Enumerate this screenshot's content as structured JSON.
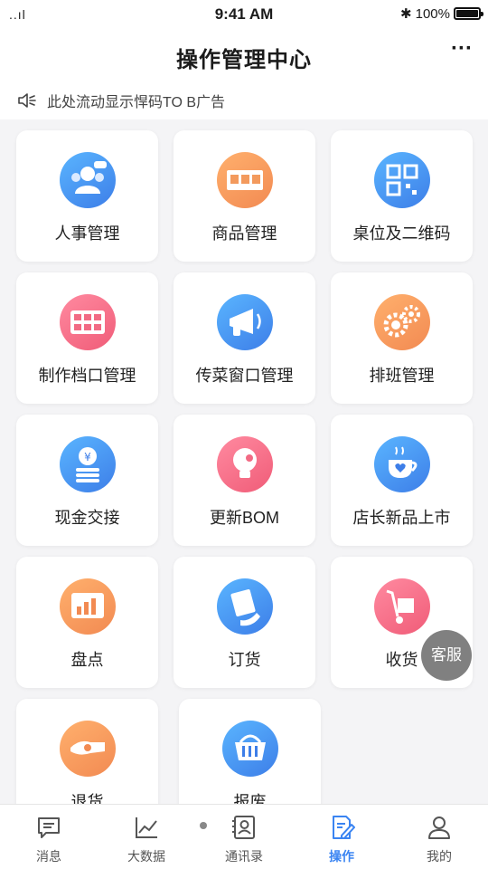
{
  "status": {
    "time": "9:41 AM",
    "signal": "..ıl",
    "wifi": "ᯤ",
    "bluetooth": "✱",
    "battery_text": "100%"
  },
  "navbar": {
    "title": "操作管理中心",
    "more": "···"
  },
  "notice": {
    "text": "此处流动显示悍码TO B广告"
  },
  "tiles": [
    {
      "label": "人事管理",
      "icon": "people-icon",
      "color": "#4c93f0"
    },
    {
      "label": "商品管理",
      "icon": "store-icon",
      "color": "#f39a5d"
    },
    {
      "label": "桌位及二维码",
      "icon": "qrcode-icon",
      "color": "#4c93f0"
    },
    {
      "label": "制作档口管理",
      "icon": "grid-window-icon",
      "color": "#f26a84"
    },
    {
      "label": "传菜窗口管理",
      "icon": "megaphone-icon",
      "color": "#4c93f0"
    },
    {
      "label": "排班管理",
      "icon": "gears-icon",
      "color": "#f39a5d"
    },
    {
      "label": "现金交接",
      "icon": "coins-icon",
      "color": "#4c93f0"
    },
    {
      "label": "更新BOM",
      "icon": "bulb-icon",
      "color": "#f26a84"
    },
    {
      "label": "店长新品上市",
      "icon": "cup-heart-icon",
      "color": "#4c93f0"
    },
    {
      "label": "盘点",
      "icon": "chart-board-icon",
      "color": "#f39a5d"
    },
    {
      "label": "订货",
      "icon": "order-hand-icon",
      "color": "#4c93f0"
    },
    {
      "label": "收货",
      "icon": "cart-icon",
      "color": "#f26a84"
    },
    {
      "label": "退货",
      "icon": "return-hand-icon",
      "color": "#f39a5d"
    },
    {
      "label": "报废",
      "icon": "basket-icon",
      "color": "#4c93f0"
    }
  ],
  "floating": {
    "label": "客服"
  },
  "tabbar": [
    {
      "label": "消息",
      "icon": "message-icon",
      "active": false
    },
    {
      "label": "大数据",
      "icon": "trend-chart-icon",
      "active": false
    },
    {
      "label": "通讯录",
      "icon": "contacts-icon",
      "active": false
    },
    {
      "label": "操作",
      "icon": "edit-doc-icon",
      "active": true
    },
    {
      "label": "我的",
      "icon": "user-icon",
      "active": false
    }
  ]
}
